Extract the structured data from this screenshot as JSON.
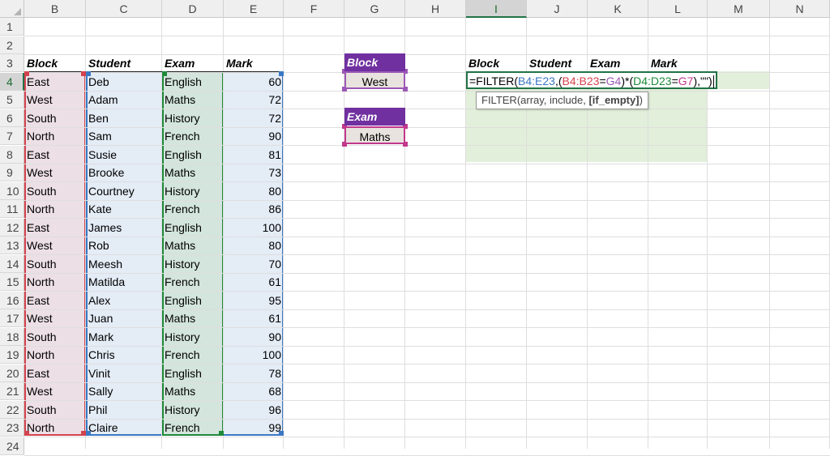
{
  "columns": [
    "B",
    "C",
    "D",
    "E",
    "F",
    "G",
    "H",
    "I",
    "J",
    "K",
    "L",
    "M",
    "N"
  ],
  "rows": [
    "1",
    "2",
    "3",
    "4",
    "5",
    "6",
    "7",
    "8",
    "9",
    "10",
    "11",
    "12",
    "13",
    "14",
    "15",
    "16",
    "17",
    "18",
    "19",
    "20",
    "21",
    "22",
    "23",
    "24"
  ],
  "table": {
    "headers": [
      "Block",
      "Student",
      "Exam",
      "Mark"
    ],
    "rows": [
      [
        "East",
        "Deb",
        "English",
        "60"
      ],
      [
        "West",
        "Adam",
        "Maths",
        "72"
      ],
      [
        "South",
        "Ben",
        "History",
        "72"
      ],
      [
        "North",
        "Sam",
        "French",
        "90"
      ],
      [
        "East",
        "Susie",
        "English",
        "81"
      ],
      [
        "West",
        "Brooke",
        "Maths",
        "73"
      ],
      [
        "South",
        "Courtney",
        "History",
        "80"
      ],
      [
        "North",
        "Kate",
        "French",
        "86"
      ],
      [
        "East",
        "James",
        "English",
        "100"
      ],
      [
        "West",
        "Rob",
        "Maths",
        "80"
      ],
      [
        "South",
        "Meesh",
        "History",
        "70"
      ],
      [
        "North",
        "Matilda",
        "French",
        "61"
      ],
      [
        "East",
        "Alex",
        "English",
        "95"
      ],
      [
        "West",
        "Juan",
        "Maths",
        "61"
      ],
      [
        "South",
        "Mark",
        "History",
        "90"
      ],
      [
        "North",
        "Chris",
        "French",
        "100"
      ],
      [
        "East",
        "Vinit",
        "English",
        "78"
      ],
      [
        "West",
        "Sally",
        "Maths",
        "68"
      ],
      [
        "South",
        "Phil",
        "History",
        "96"
      ],
      [
        "North",
        "Claire",
        "French",
        "99"
      ]
    ]
  },
  "inputs": {
    "block_label": "Block",
    "block_value": "West",
    "exam_label": "Exam",
    "exam_value": "Maths"
  },
  "output": {
    "headers": [
      "Block",
      "Student",
      "Exam",
      "Mark"
    ]
  },
  "formula": {
    "parts": [
      {
        "text": "=FILTER(",
        "color": "#000000"
      },
      {
        "text": "B4:E23",
        "color": "#3a78c4"
      },
      {
        "text": ",(",
        "color": "#000000"
      },
      {
        "text": "B4:B23",
        "color": "#d4434d"
      },
      {
        "text": "=",
        "color": "#000000"
      },
      {
        "text": "G4",
        "color": "#9b59b6"
      },
      {
        "text": ")*(",
        "color": "#000000"
      },
      {
        "text": "D4:D23",
        "color": "#1e8a3a"
      },
      {
        "text": "=",
        "color": "#000000"
      },
      {
        "text": "G7",
        "color": "#c2388c"
      },
      {
        "text": "),\"\")",
        "color": "#000000"
      }
    ],
    "tooltip_prefix": "FILTER(array, include, ",
    "tooltip_bold": "[if_empty]",
    "tooltip_suffix": ")"
  },
  "selected": {
    "column": "I",
    "row": "4"
  },
  "colors": {
    "accent": "#217346",
    "input_header": "#7030a0",
    "output_fill": "#e2efda"
  }
}
